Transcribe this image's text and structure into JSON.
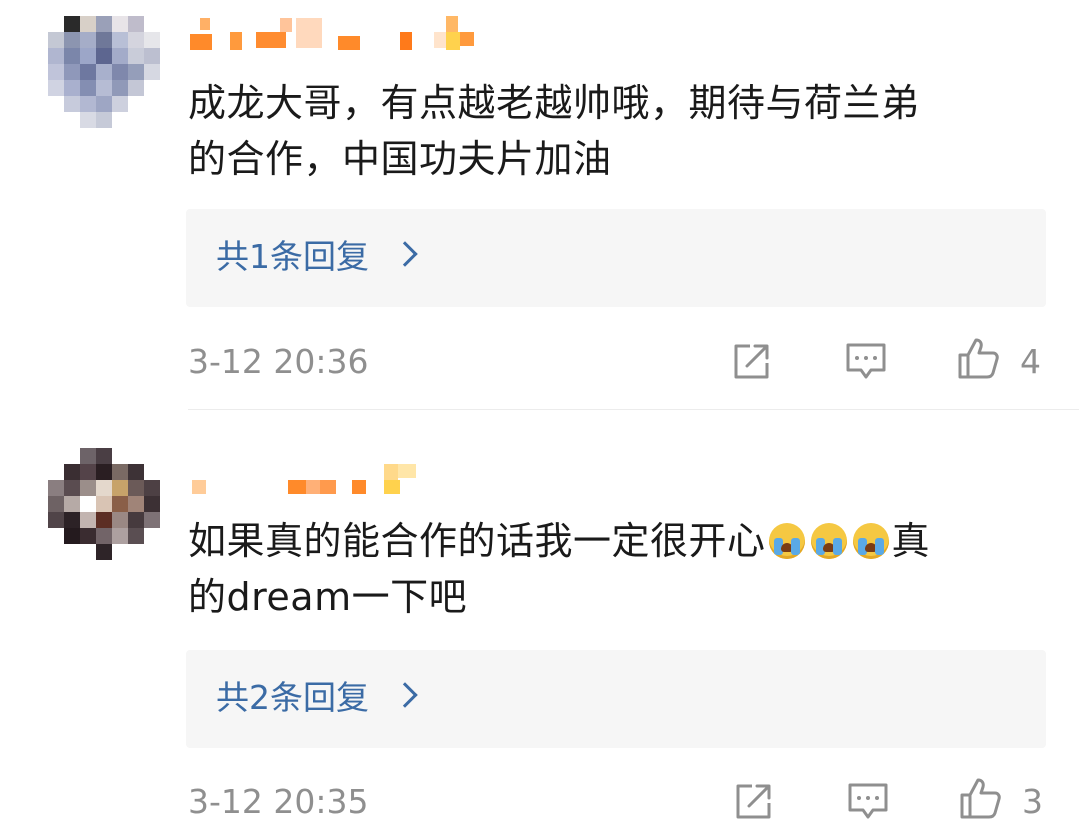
{
  "comments": [
    {
      "username_pixelated": true,
      "text_main": "成龙大哥，有点越老越帅哦，期待与荷兰弟",
      "text_cont": "的合作，中国功夫片加油",
      "emojis": [],
      "text_after_emoji": "",
      "replies_label": "共1条回复",
      "timestamp": "3-12 20:36",
      "like_count": "4"
    },
    {
      "username_pixelated": true,
      "text_main": "如果真的能合作的话我一定很开心",
      "emojis": [
        "crying-face-emoji",
        "crying-face-emoji",
        "crying-face-emoji"
      ],
      "text_after_emoji": "真",
      "text_cont": "的dream一下吧",
      "replies_label": "共2条回复",
      "timestamp": "3-12 20:35",
      "like_count": "3"
    }
  ],
  "icons": {
    "share": "share-icon",
    "comment": "comment-icon",
    "like": "thumbs-up-icon"
  },
  "colors": {
    "link": "#3b6ba5",
    "meta": "#8f8f8f",
    "reply_bg": "#f6f6f6",
    "username": "#ff8c2e"
  }
}
